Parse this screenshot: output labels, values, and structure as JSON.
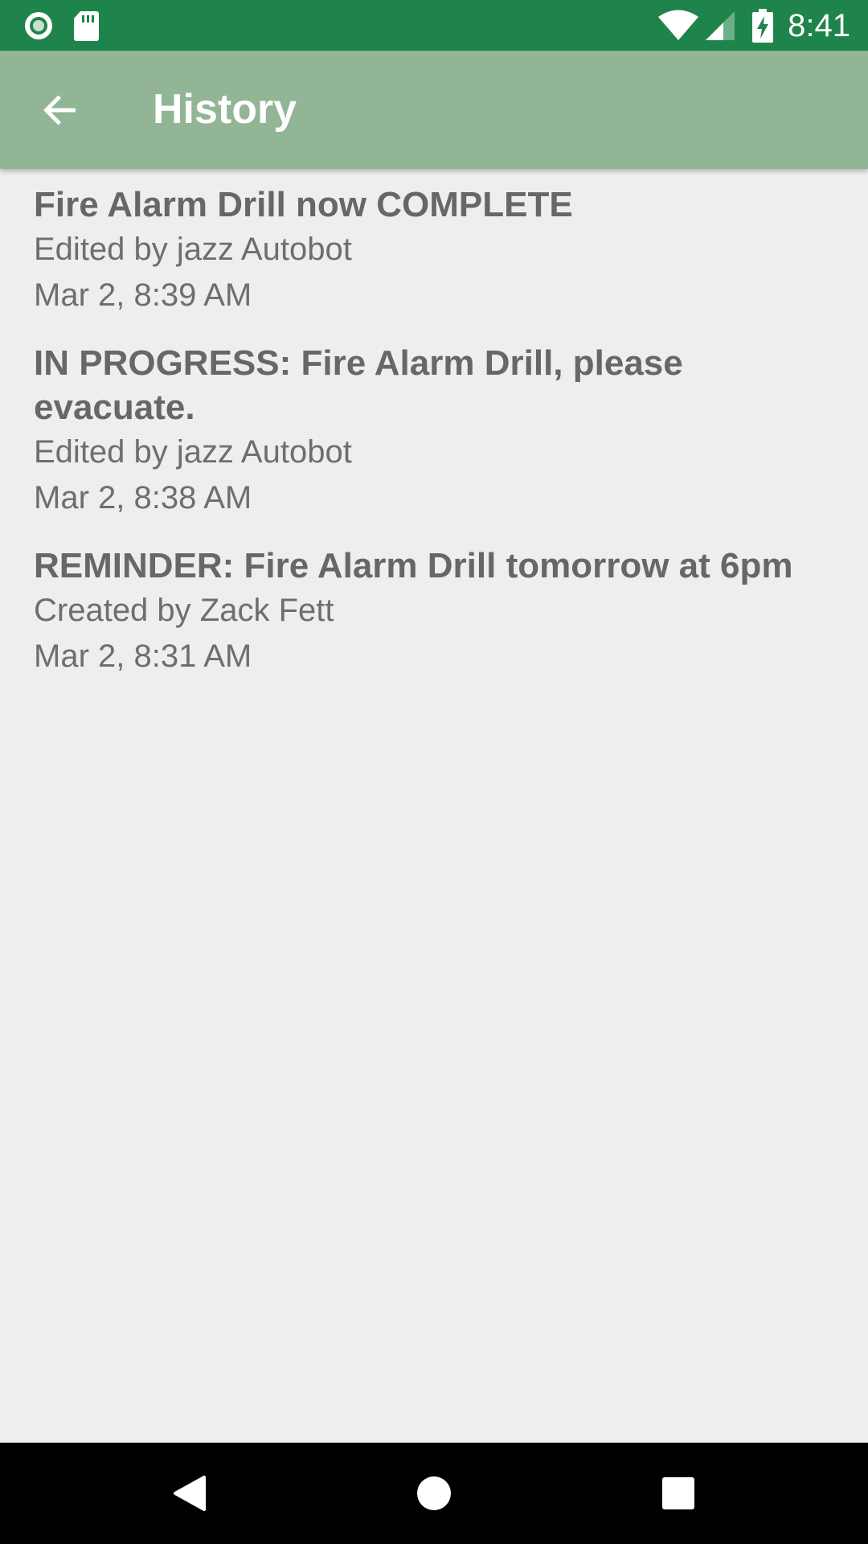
{
  "status_bar": {
    "time": "8:41",
    "icons": [
      "radio-icon",
      "sd-card-icon",
      "wifi-icon",
      "cell-signal-icon",
      "battery-charging-icon"
    ],
    "color": "#1f844b"
  },
  "app_bar": {
    "title": "History",
    "back_icon": "arrow-back-icon",
    "color": "#91b595"
  },
  "history": [
    {
      "title": "Fire Alarm Drill now COMPLETE",
      "author": "Edited by jazz Autobot",
      "timestamp": "Mar 2, 8:39 AM"
    },
    {
      "title": "IN PROGRESS: Fire Alarm Drill, please evacuate.",
      "author": "Edited by jazz Autobot",
      "timestamp": "Mar 2, 8:38 AM"
    },
    {
      "title": "REMINDER: Fire Alarm Drill tomorrow at 6pm",
      "author": "Created by Zack Fett",
      "timestamp": "Mar 2, 8:31 AM"
    }
  ],
  "nav_bar": {
    "buttons": [
      "back-triangle-icon",
      "home-circle-icon",
      "recents-square-icon"
    ]
  }
}
